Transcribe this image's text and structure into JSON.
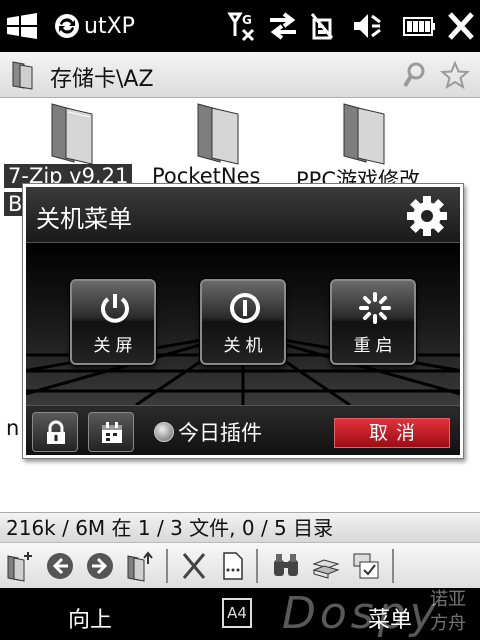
{
  "statusbar": {
    "app_title": "utXP",
    "icons": [
      "windows-start-icon",
      "sync-icon",
      "signal-icon",
      "data-transfer-icon",
      "connectivity-icon",
      "volume-mute-icon",
      "battery-icon",
      "close-icon"
    ]
  },
  "pathbar": {
    "path": "存储卡\\AZ"
  },
  "files": [
    {
      "name": "7-Zip v9.21",
      "name_line2": "B",
      "selected": true
    },
    {
      "name": "PocketNes",
      "selected": false
    },
    {
      "name": "PPC游戏修改",
      "selected": false
    },
    {
      "name": "n",
      "selected": false
    }
  ],
  "dialog": {
    "title": "关机菜单",
    "buttons": [
      {
        "label": "关屏",
        "icon": "screen-off-icon"
      },
      {
        "label": "关机",
        "icon": "power-off-icon"
      },
      {
        "label": "重启",
        "icon": "restart-icon"
      }
    ],
    "plugin_label": "今日插件",
    "cancel_label": "取消"
  },
  "statusline": {
    "text": "216k / 6M 在 1 / 3 文件, 0 / 5 目录"
  },
  "toolbar": {
    "icons": [
      "new-folder-icon",
      "back-icon",
      "forward-icon",
      "up-folder-icon",
      "cut-icon",
      "rename-icon",
      "find-icon",
      "copy-icon",
      "paste-icon"
    ]
  },
  "softkeys": {
    "left": "向上",
    "ime": "A4",
    "right": "菜单",
    "watermark": "Dospy",
    "watermark_cn": "诺亚方舟"
  },
  "colors": {
    "cancel_red": "#c4161f",
    "dialog_bg": "#000000"
  }
}
